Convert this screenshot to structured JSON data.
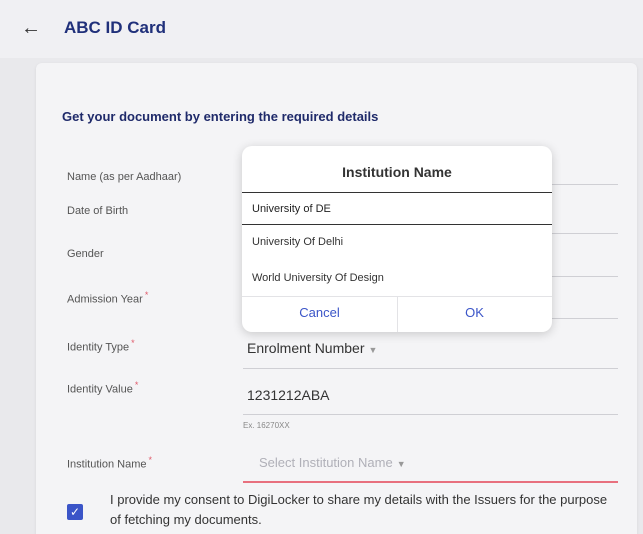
{
  "header": {
    "back_icon": "←",
    "title": "ABC ID Card"
  },
  "form": {
    "heading": "Get your document by entering the required details",
    "fields": [
      {
        "label": "Name (as per Aadhaar)",
        "required": false,
        "value": ""
      },
      {
        "label": "Date of Birth",
        "required": false,
        "value": ""
      },
      {
        "label": "Gender",
        "required": false,
        "value": ""
      },
      {
        "label": "Admission Year",
        "required": true,
        "value": ""
      },
      {
        "label": "Identity Type",
        "required": true,
        "value": "Enrolment Number"
      },
      {
        "label": "Identity Value",
        "required": true,
        "value": "1231212ABA",
        "hint": "Ex. 16270XX"
      },
      {
        "label": "Institution Name",
        "required": true,
        "placeholder": "Select Institution Name"
      }
    ],
    "required_mark": "*",
    "consent": "I provide my consent to DigiLocker to share my details with the Issuers for the purpose of fetching my documents.",
    "consent_checked": true
  },
  "modal": {
    "title": "Institution Name",
    "search_value": "University of DE",
    "options": [
      "University Of Delhi",
      "World University Of Design"
    ],
    "cancel_label": "Cancel",
    "ok_label": "OK"
  },
  "colors": {
    "accent": "#3b55c8",
    "title": "#20307a",
    "error": "#e8707e"
  }
}
